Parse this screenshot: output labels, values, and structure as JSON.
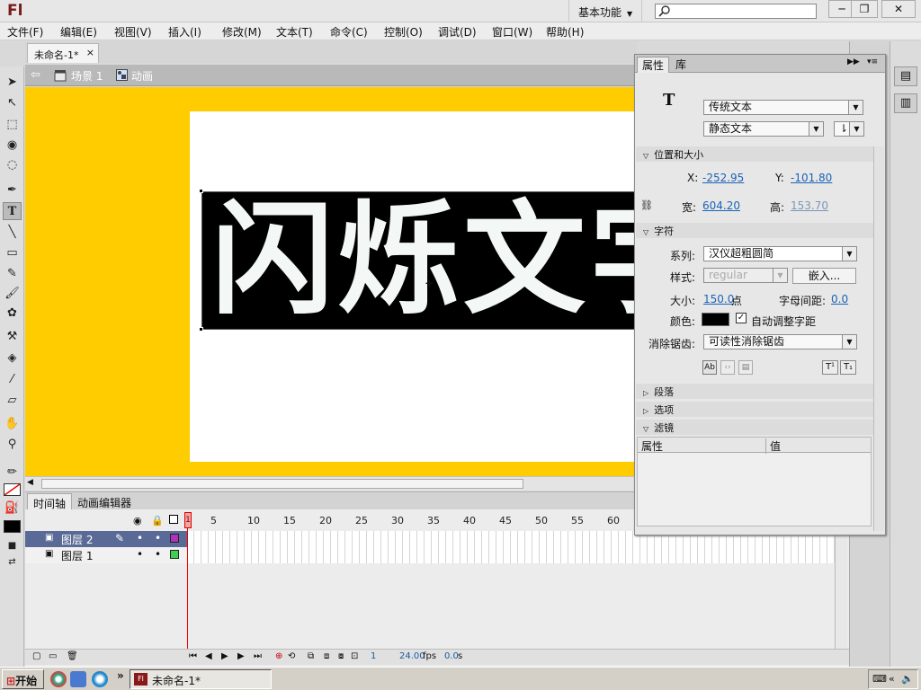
{
  "app": {
    "logo": "Fl",
    "workspace": "基本功能"
  },
  "window_buttons": {
    "min": "─",
    "max": "❐",
    "close": "✕"
  },
  "menu": [
    "文件(F)",
    "编辑(E)",
    "视图(V)",
    "插入(I)",
    "修改(M)",
    "文本(T)",
    "命令(C)",
    "控制(O)",
    "调试(D)",
    "窗口(W)",
    "帮助(H)"
  ],
  "doc_tab": {
    "title": "未命名-1*",
    "close": "×"
  },
  "scene": {
    "scene_label": "场景 1",
    "symbol_label": "动画"
  },
  "stage_text": "闪烁文字",
  "timeline": {
    "tabs": [
      "时间轴",
      "动画编辑器"
    ],
    "frame_numbers": [
      "1",
      "5",
      "10",
      "15",
      "20",
      "25",
      "30",
      "35",
      "40",
      "45",
      "50",
      "55",
      "60"
    ],
    "layers": [
      {
        "name": "图层 2",
        "selected": true,
        "outline_color": "#b030c0"
      },
      {
        "name": "图层 1",
        "selected": false,
        "outline_color": "#40d050"
      }
    ],
    "status": {
      "frame": "1",
      "fps": "24.00",
      "fps_unit": "fps",
      "time": "0.0",
      "time_unit": "s"
    }
  },
  "properties": {
    "tabs": [
      "属性",
      "库"
    ],
    "text_type": "传统文本",
    "text_subtype": "静态文本",
    "section_position": "位置和大小",
    "x_label": "X:",
    "x_value": "-252.95",
    "y_label": "Y:",
    "y_value": "-101.80",
    "w_label": "宽:",
    "w_value": "604.20",
    "h_label": "高:",
    "h_value": "153.70",
    "section_character": "字符",
    "family_label": "系列:",
    "family_value": "汉仪超粗圆简",
    "style_label": "样式:",
    "style_value": "regular",
    "embed_button": "嵌入...",
    "size_label": "大小:",
    "size_value": "150.0",
    "size_unit": "点",
    "spacing_label": "字母间距:",
    "spacing_value": "0.0",
    "color_label": "颜色:",
    "text_color": "#000000",
    "autokern_label": "自动调整字距",
    "autokern_checked": true,
    "antialias_label": "消除锯齿:",
    "antialias_value": "可读性消除锯齿",
    "section_paragraph": "段落",
    "section_options": "选项",
    "section_filters": "滤镜",
    "filter_columns": [
      "属性",
      "值"
    ]
  },
  "taskbar": {
    "start": "开始",
    "task_title": "未命名-1*",
    "task_icon": "Fl"
  },
  "colors": {
    "pasteboard": "#ffcc00",
    "selected_layer": "#5a6a96",
    "accent_link": "#1b63b8"
  }
}
